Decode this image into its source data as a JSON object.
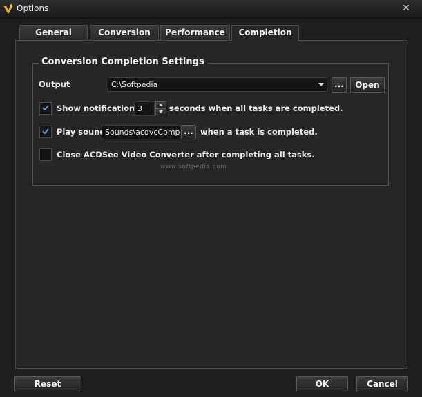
{
  "window": {
    "title": "Options",
    "close_glyph": "✕",
    "app_icon": "acdsee-logo-icon"
  },
  "tabs": [
    {
      "label": "General",
      "active": false
    },
    {
      "label": "Conversion",
      "active": false
    },
    {
      "label": "Performance",
      "active": false
    },
    {
      "label": "Completion",
      "active": true
    }
  ],
  "group": {
    "title": "Conversion Completion Settings"
  },
  "output": {
    "label": "Output",
    "value": "C:\\Softpedia",
    "browse_label": "...",
    "open_label": "Open"
  },
  "notification": {
    "checked": true,
    "label": "Show notification fo",
    "value": "3",
    "suffix": "seconds when all tasks are completed."
  },
  "play_sound": {
    "checked": true,
    "label": "Play sound",
    "value": "Sounds\\acdvcComplet",
    "browse_label": "...",
    "suffix": "when a task is completed."
  },
  "close_after": {
    "checked": false,
    "label": "Close ACDSee Video Converter after completing all tasks."
  },
  "footer": {
    "reset_label": "Reset",
    "ok_label": "OK",
    "cancel_label": "Cancel"
  },
  "watermark": {
    "url": "www.softpedia.com"
  },
  "colors": {
    "checkmark": "#4aa3e6",
    "background": "#1e1e1e",
    "panel": "#262626"
  }
}
